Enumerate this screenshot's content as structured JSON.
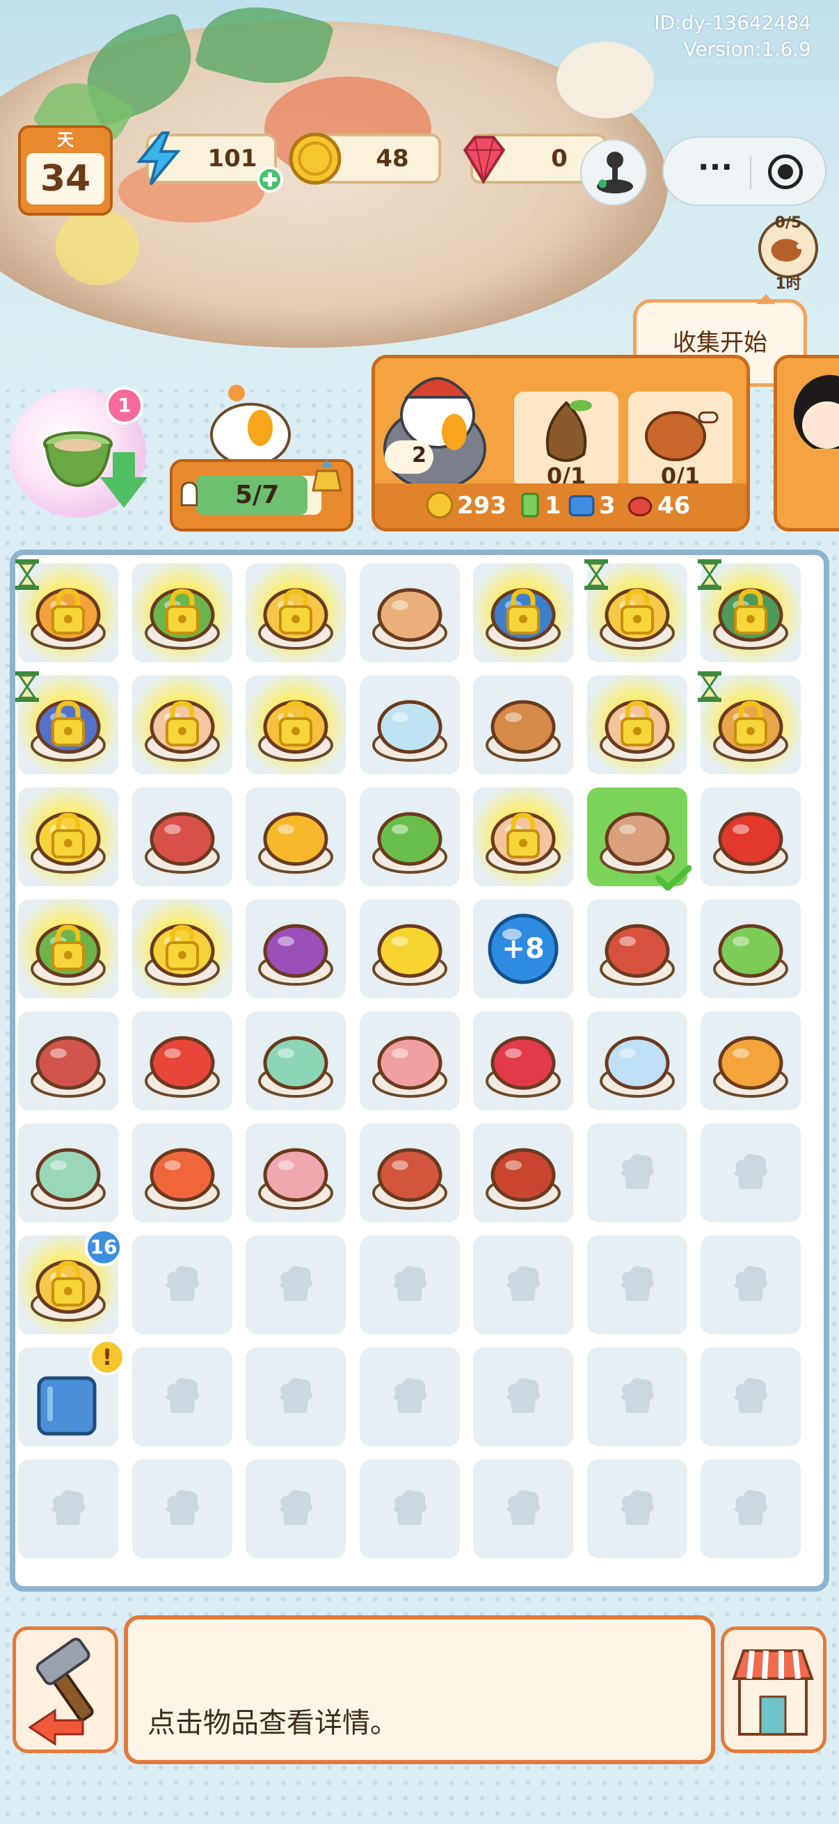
{
  "header": {
    "player_id": "ID:dy-13642484",
    "version": "Version:1.6.9"
  },
  "hud": {
    "day_label": "天",
    "day_value": "34",
    "energy": "101",
    "coins": "48",
    "gems": "0"
  },
  "collection": {
    "progress": "0/5",
    "timer": "1时",
    "bubble_text": "收集开始"
  },
  "producer": {
    "badge": "1"
  },
  "helper": {
    "count": "5/7"
  },
  "order": {
    "customer_level": "2",
    "items": [
      {
        "name": "pear",
        "count": "0/1"
      },
      {
        "name": "roast-chicken-leg",
        "count": "0/1"
      }
    ],
    "rewards": {
      "coins": "293",
      "green_item": "1",
      "blue_item": "3",
      "meat_item": "46"
    }
  },
  "board": {
    "rows": [
      [
        "cutting-table-locked",
        "salad-bowl-locked",
        "food-cart-locked",
        "iced-coffee-cup",
        "ice-machine-locked",
        "blender-locked",
        "pot-stove-locked"
      ],
      [
        "grill-locked",
        "fish-tank-locked",
        "fishing-rod-locked",
        "glass-bowl",
        "latte-cup",
        "bottle-locked",
        "cutting-board-locked"
      ],
      [
        "corn-dish-locked",
        "pork-belly",
        "mango",
        "green-onion",
        "bottle-locked",
        "pizza-plate",
        "chili-pepper-dish"
      ],
      [
        "salad-bowl-locked",
        "corn-dish-locked",
        "onion",
        "lemon",
        "energy-plus-bubble",
        "ribs",
        "lettuce"
      ],
      [
        "beef-steak",
        "apple",
        "oyster",
        "chicken-breast",
        "strawberry",
        "ice-cube",
        "pudding-cup"
      ],
      [
        "clam",
        "red-fish",
        "pink-meat",
        "bacon",
        "sausage",
        "empty",
        "empty"
      ],
      [
        "food-basket-locked",
        "empty",
        "empty",
        "empty",
        "empty",
        "empty",
        "empty"
      ],
      [
        "storage-box",
        "empty",
        "empty",
        "empty",
        "empty",
        "empty",
        "empty"
      ],
      [
        "empty",
        "empty",
        "empty",
        "empty",
        "empty",
        "empty",
        "empty"
      ]
    ],
    "energy_bubble_label": "+8",
    "basket_badge": "16"
  },
  "footer": {
    "message": "点击物品查看详情。"
  },
  "colors": {
    "accent_orange": "#e8892d",
    "board_border": "#8db4cc",
    "selected_cell": "#7cd35a"
  }
}
